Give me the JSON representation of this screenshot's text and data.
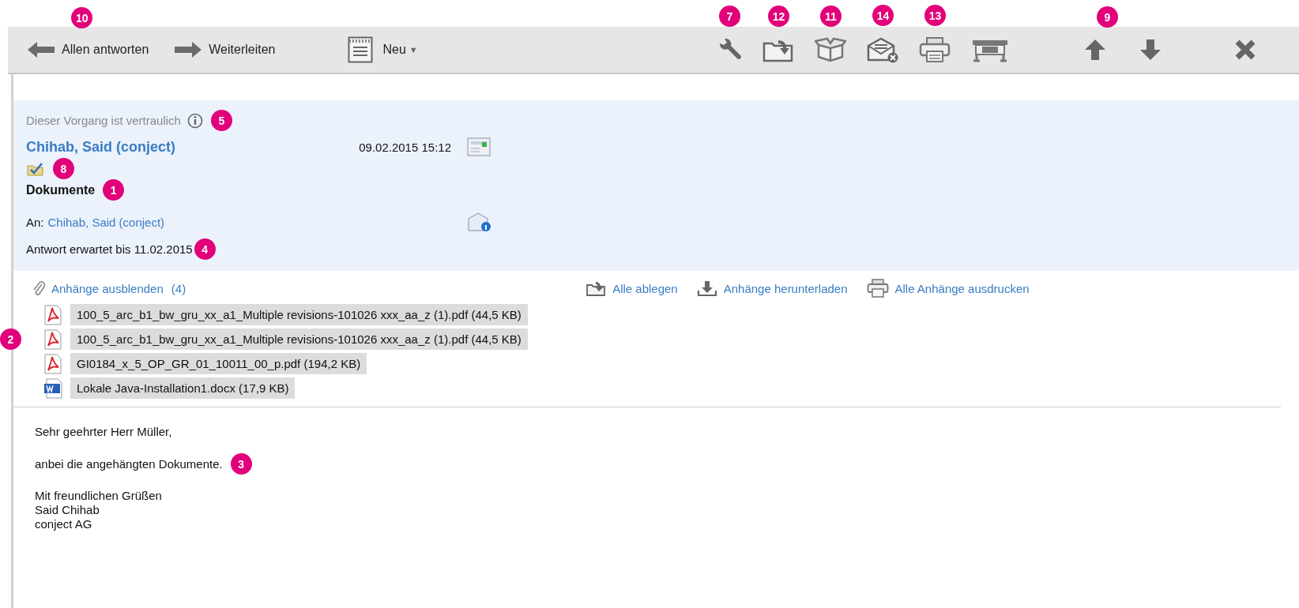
{
  "toolbar": {
    "actions": [
      {
        "kind": "reply-all",
        "label": "Allen antworten",
        "callout": "10"
      },
      {
        "kind": "forward",
        "label": "Weiterleiten"
      },
      {
        "kind": "new",
        "label": "Neu",
        "caret": "▼"
      }
    ],
    "tools": [
      {
        "kind": "wrench",
        "callout": "7"
      },
      {
        "kind": "file-to-folder",
        "callout": "12"
      },
      {
        "kind": "box",
        "callout": "11"
      },
      {
        "kind": "mail-cancel",
        "callout": "14"
      },
      {
        "kind": "printer",
        "callout": "13"
      },
      {
        "kind": "plotter"
      }
    ],
    "nav": {
      "callout": "9",
      "buttons": [
        {
          "kind": "up"
        },
        {
          "kind": "down"
        }
      ]
    },
    "end_tools": [
      {
        "kind": "close"
      }
    ]
  },
  "header": {
    "confidential": {
      "text": "Dieser Vorgang ist vertraulich",
      "callout": "5"
    },
    "sender": "Chihab, Said (conject)",
    "date": "09.02.2015 15:12",
    "flag": {
      "callout": "8"
    },
    "subject": {
      "text": "Dokumente",
      "callout": "1"
    },
    "recipient": {
      "label": "An:",
      "name": "Chihab, Said (conject)"
    },
    "due": {
      "text": "Antwort erwartet bis 11.02.2015",
      "callout": "4"
    }
  },
  "attachments": {
    "toggle": "Anhänge ausblenden",
    "count": "(4)",
    "actions": [
      {
        "kind": "file-to-folder",
        "label": "Alle ablegen"
      },
      {
        "kind": "download",
        "label": "Anhänge herunterladen"
      },
      {
        "kind": "printer",
        "label": "Alle Anhänge ausdrucken"
      }
    ],
    "files": [
      {
        "kind": "pdf",
        "name": "100_5_arc_b1_bw_gru_xx_a1_Multiple revisions-101026 xxx_aa_z (1).pdf (44,5 KB)"
      },
      {
        "kind": "pdf",
        "name": "100_5_arc_b1_bw_gru_xx_a1_Multiple revisions-101026 xxx_aa_z (1).pdf (44,5 KB)",
        "callout": "2"
      },
      {
        "kind": "pdf",
        "name": "GI0184_x_5_OP_GR_01_10011_00_p.pdf (194,2 KB)"
      },
      {
        "kind": "docx",
        "name": "Lokale Java-Installation1.docx (17,9 KB)"
      }
    ]
  },
  "body": [
    {
      "lines": [
        "Sehr geehrter Herr Müller,"
      ]
    },
    {
      "lines": [
        "anbei die angehängten Dokumente."
      ],
      "callout": "3"
    },
    {
      "lines": [
        "Mit freundlichen Grüßen",
        "Said Chihab",
        "conject AG"
      ]
    }
  ]
}
